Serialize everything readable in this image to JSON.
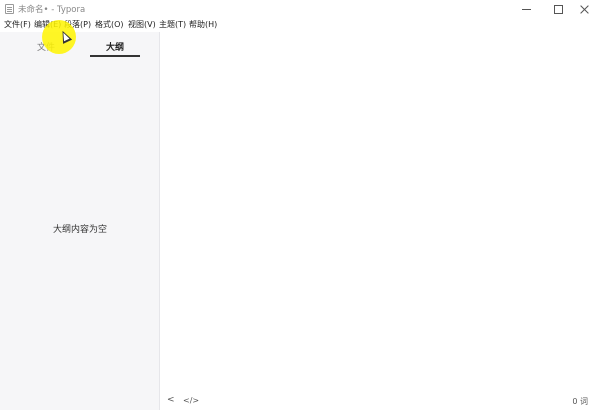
{
  "window": {
    "title": "未命名• - Typora",
    "icon": "typora-app-icon",
    "controls": {
      "minimize": "minimize-icon",
      "maximize": "maximize-icon",
      "close": "close-icon"
    }
  },
  "menubar": {
    "items": [
      {
        "label": "文件(F)"
      },
      {
        "label": "编辑(E)"
      },
      {
        "label": "段落(P)"
      },
      {
        "label": "格式(O)"
      },
      {
        "label": "视图(V)"
      },
      {
        "label": "主题(T)"
      },
      {
        "label": "帮助(H)"
      }
    ]
  },
  "sidebar": {
    "tabs": [
      {
        "label": "文件",
        "active": false
      },
      {
        "label": "大纲",
        "active": true
      }
    ],
    "empty_message": "大纲内容为空"
  },
  "statusbar": {
    "back_icon": "chevron-left-icon",
    "back_label": "<",
    "source_icon": "code-icon",
    "source_label": "</>",
    "word_count": "0 词"
  },
  "colors": {
    "sidebar_bg": "#f6f6f8",
    "cursor_highlight": "#fff500"
  }
}
